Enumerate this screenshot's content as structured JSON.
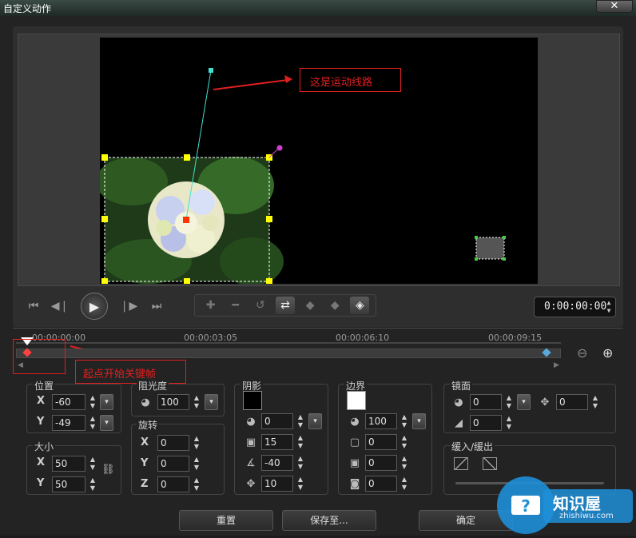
{
  "window": {
    "title": "自定义动作",
    "close_glyph": "✕"
  },
  "annotations": {
    "path_label": "这是运动线路",
    "start_label": "起点开始关键帧"
  },
  "transport": {
    "timecode": "0:00:00:00"
  },
  "timeline": {
    "ticks": [
      "00:00:00:00",
      "00:00:03:05",
      "00:00:06:10",
      "00:00:09:15"
    ]
  },
  "position": {
    "label": "位置",
    "x_axis": "X",
    "y_axis": "Y",
    "x": "-60",
    "y": "-49"
  },
  "size": {
    "label": "大小",
    "x_axis": "X",
    "y_axis": "Y",
    "x": "50",
    "y": "50"
  },
  "opacity": {
    "label": "阻光度",
    "value": "100"
  },
  "rotation": {
    "label": "旋转",
    "x_axis": "X",
    "y_axis": "Y",
    "z_axis": "Z",
    "x": "0",
    "y": "0",
    "z": "0"
  },
  "shadow": {
    "label": "阴影",
    "color": "#000000",
    "opacity": "0",
    "blur": "15",
    "angle": "-40",
    "distance": "10"
  },
  "border": {
    "label": "边界",
    "color": "#ffffff",
    "opacity": "100",
    "width": "0",
    "field2": "0",
    "field3": "0"
  },
  "mirror": {
    "label": "镜面",
    "opacity": "0",
    "offset": "0",
    "fade": "0"
  },
  "ease": {
    "label": "缓入/缓出"
  },
  "buttons": {
    "reset": "重置",
    "save_to": "保存至...",
    "ok": "确定"
  },
  "watermark": {
    "name": "知识屋",
    "url": "zhishiwu.com"
  },
  "colors": {
    "annotation_red": "#e02020",
    "handle_yellow": "#ffff00",
    "path_cyan": "#40e0d0",
    "keyframe_blue": "#5aa8d8"
  }
}
